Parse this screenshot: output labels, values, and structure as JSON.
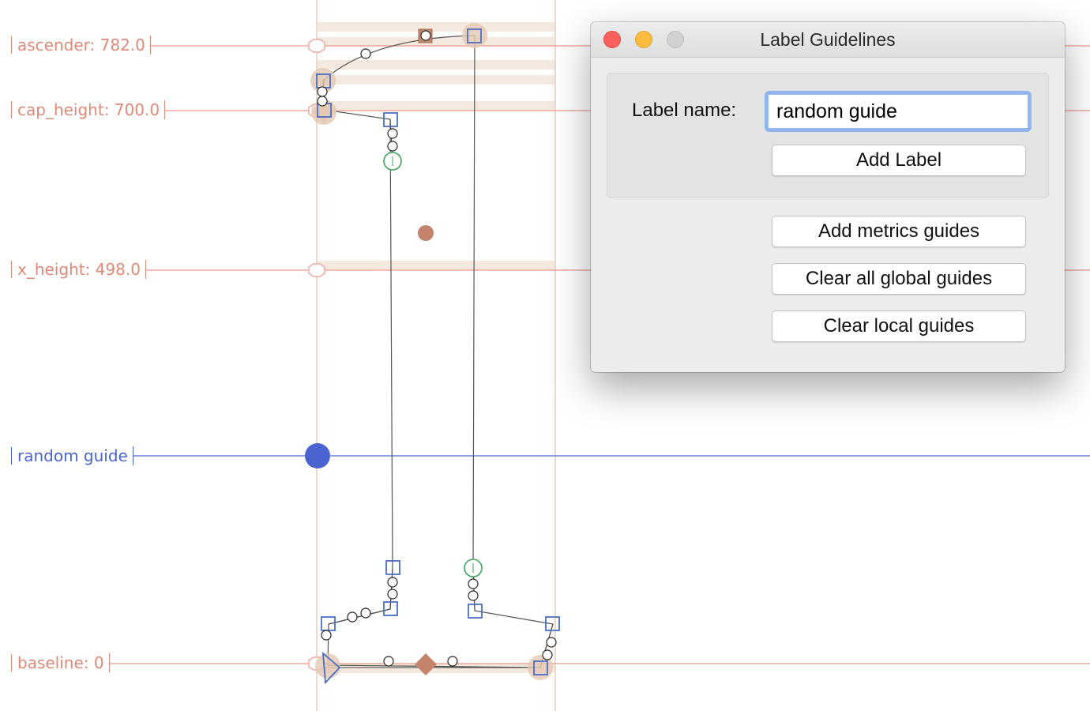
{
  "colors": {
    "metric_guide": "#dd8a78",
    "custom_guide": "#4a64cf",
    "outline_point": "#4a6fc4",
    "off_curve": "#222222",
    "anchor": "#c4846c",
    "tangent": "#3aa35a"
  },
  "guides": {
    "ascender": "ascender: 782.0",
    "cap_height": "cap_height: 700.0",
    "x_height": "x_height: 498.0",
    "random": "random guide",
    "baseline": "baseline: 0"
  },
  "dialog": {
    "title": "Label Guidelines",
    "label_name_caption": "Label name:",
    "label_name_value": "random guide",
    "add_label": "Add Label",
    "add_metrics": "Add metrics guides",
    "clear_global": "Clear all global guides",
    "clear_local": "Clear local guides"
  }
}
